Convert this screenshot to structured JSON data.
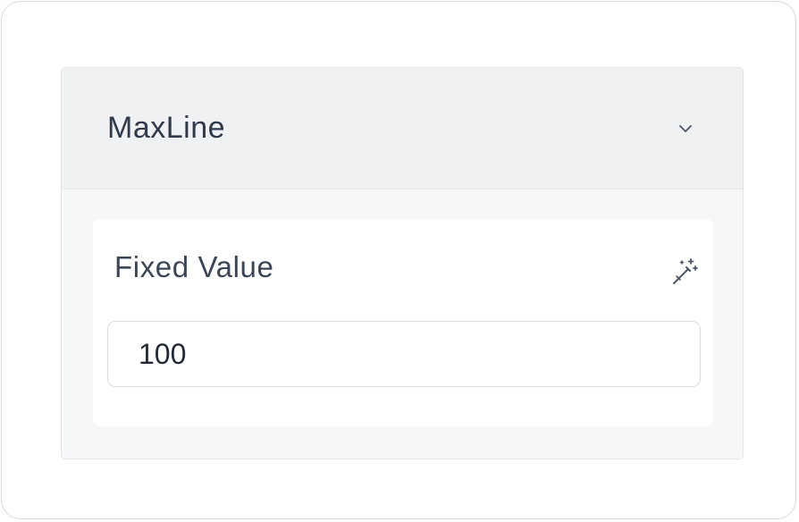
{
  "panel": {
    "title": "MaxLine",
    "expanded": true
  },
  "field": {
    "label": "Fixed Value",
    "value": "100",
    "action_icon": "magic-wand-icon"
  },
  "icons": {
    "collapse": "chevron-down-icon"
  },
  "colors": {
    "header_bg": "#f0f1f3",
    "panel_bg": "#f6f7f9",
    "text": "#2f3a4b"
  }
}
